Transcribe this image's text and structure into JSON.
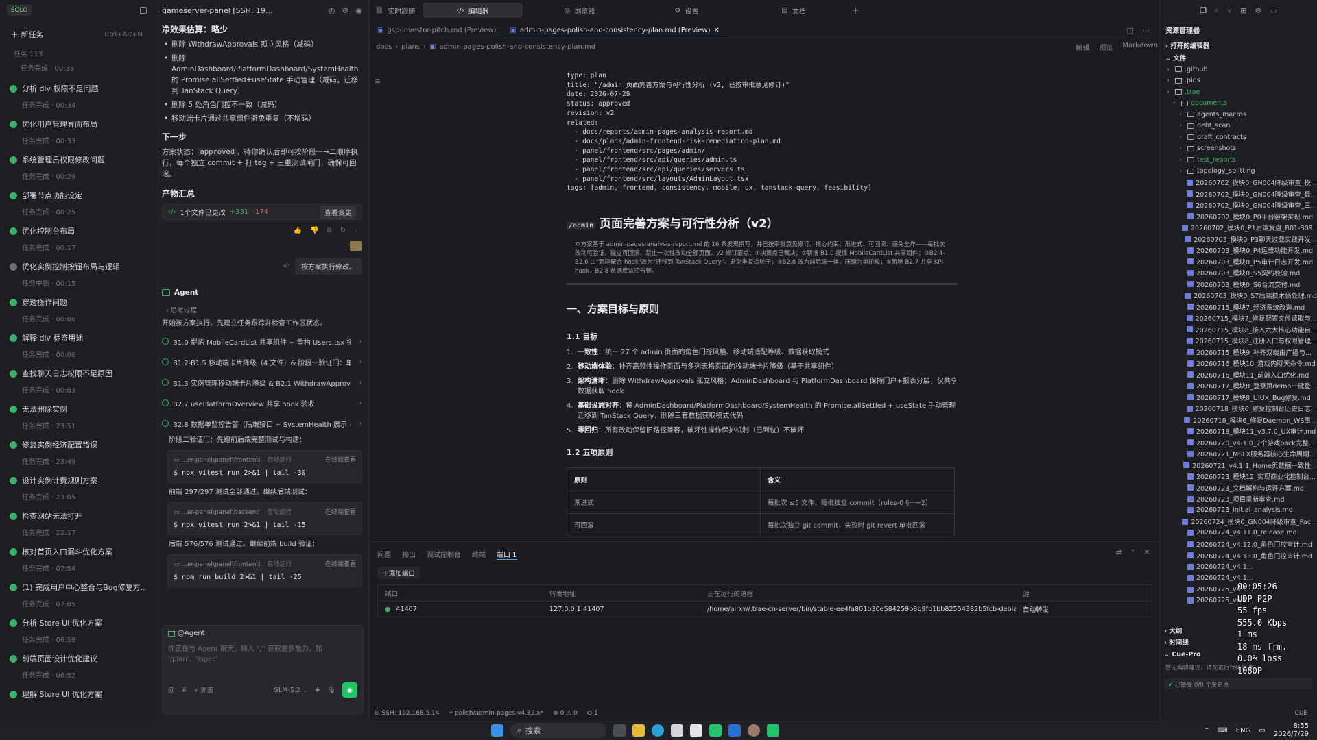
{
  "window": {
    "title": "gameserver-panel [SSH: 19...",
    "logo": "SOLO"
  },
  "top_tabs": [
    {
      "label": "实时跟随",
      "icon": "link-icon"
    },
    {
      "label": "编辑器",
      "icon": "code-icon"
    },
    {
      "label": "浏览器",
      "icon": "globe-icon"
    },
    {
      "label": "设置",
      "icon": "gear-icon"
    },
    {
      "label": "文档",
      "icon": "doc-icon"
    }
  ],
  "tasks": {
    "new_task": "新任务",
    "shortcut": "Ctrl+Alt+N",
    "count_label": "任务  113",
    "first_sub": "任务完成 · 00:35",
    "items": [
      {
        "title": "分析 div 权限不足问题",
        "sub": "任务完成 · 00:34",
        "status": "done"
      },
      {
        "title": "优化用户管理界面布局",
        "sub": "任务完成 · 00:33",
        "status": "done"
      },
      {
        "title": "系统管理员权限修改问题",
        "sub": "任务完成 · 00:29",
        "status": "done"
      },
      {
        "title": "部署节点功能设定",
        "sub": "任务完成 · 00:25",
        "status": "done"
      },
      {
        "title": "优化控制台布局",
        "sub": "任务完成 · 00:17",
        "status": "done"
      },
      {
        "title": "优化实例控制按钮布局与逻辑",
        "sub": "任务中断 · 00:15",
        "status": "stopped"
      },
      {
        "title": "穿透操作问题",
        "sub": "任务完成 · 00:06",
        "status": "done"
      },
      {
        "title": "解释 div 标签用途",
        "sub": "任务完成 · 00:06",
        "status": "done"
      },
      {
        "title": "查找聊天日志权限不足原因",
        "sub": "任务完成 · 00:03",
        "status": "done"
      },
      {
        "title": "无法删除实例",
        "sub": "任务完成 · 23:51",
        "status": "done"
      },
      {
        "title": "修复实例经济配置错误",
        "sub": "任务完成 · 23:49",
        "status": "done"
      },
      {
        "title": "设计实例计费规则方案",
        "sub": "任务完成 · 23:05",
        "status": "done"
      },
      {
        "title": "检查网站无法打开",
        "sub": "任务完成 · 22:17",
        "status": "done"
      },
      {
        "title": "核对首页入口漏斗优化方案",
        "sub": "任务完成 · 07:54",
        "status": "done"
      },
      {
        "title": "(1) 完成用户中心整合与Bug修复方...",
        "sub": "任务完成 · 07:05",
        "status": "done"
      },
      {
        "title": "分析 Store UI 优化方案",
        "sub": "任务完成 · 06:59",
        "status": "done"
      },
      {
        "title": "前端页面设计优化建议",
        "sub": "任务完成 · 06:52",
        "status": "done"
      },
      {
        "title": "理解 Store UI 优化方案",
        "sub": "",
        "status": "done"
      }
    ]
  },
  "chat": {
    "section1_title": "净效果估算：略少",
    "bullets": [
      "删除 WithdrawApprovals 孤立风格（减码）",
      "删除 AdminDashboard/PlatformDashboard/SystemHealth 的 Promise.allSettled+useState 手动管理（减码，迁移到 TanStack Query）",
      "删除 5 处角色门控不一致（减码）",
      "移动端卡片通过共享组件避免重复（不增码）"
    ],
    "next_title": "下一步",
    "next_text_a": "方案状态：",
    "next_code": "approved",
    "next_text_b": "，待你确认后即可按阶段一→二顺序执行，每个独立 commit + 打 tag + 三重测试闸门，确保可回滚。",
    "summary_title": "产物汇总",
    "changes": "1个文件已更改",
    "adds": "+331",
    "dels": "-174",
    "view_changes": "查看变更",
    "user_msg": "按方案执行修改。",
    "agent_label": "Agent",
    "thinking": "思考过程",
    "start_text": "开始按方案执行。先建立任务跟踪并检查工作区状态。",
    "steps": [
      "B1.0 提炼 MobileCardList 共享组件 + 重构 Users.tsx 接入...",
      "B1.2-B1.5 移动端卡片降级（4 文件）& 阶段一验证门：单测...",
      "B1.3 实例管理移动端卡片降级 & B2.1 WithdrawApprovals 风...",
      "B2.7 usePlatformOverview 共享 hook 验收",
      "B2.8 数据单监控告警（后端接口 + SystemHealth 展示 + 单测）"
    ],
    "phase2": "阶段二验证门：先跑前后端完整测试与构建：",
    "terms": [
      {
        "path": "...er-panel\\panel\\frontend",
        "mode": "自动运行",
        "open": "在终端查看",
        "cmd": "$ npx vitest run 2>&1 | tail -30"
      },
      {
        "path": "...er-panel\\panel\\backend",
        "mode": "自动运行",
        "open": "在终端查看",
        "cmd": "$ npx vitest run 2>&1 | tail -15"
      },
      {
        "path": "...er-panel\\panel\\frontend",
        "mode": "自动运行",
        "open": "在终端查看",
        "cmd": "$ npm run build 2>&1 | tail -25"
      }
    ],
    "front_pass": "前端 297/297 测试全部通过。继续后端测试：",
    "back_pass": "后端 576/576 测试通过。继续前端 build 验证：",
    "input_mention": "@Agent",
    "input_placeholder": "你正在与 Agent 聊天，输入 \"/\" 获取更多能力，如 '/plan'、'/spec'",
    "model": "GLM-5.2",
    "source_btn": "溯源"
  },
  "editor": {
    "file_tabs": [
      "gsp-investor-pitch.md (Preview)",
      "admin-pages-polish-and-consistency-plan.md (Preview)"
    ],
    "breadcrumb": [
      "docs",
      "plans",
      "admin-pages-polish-and-consistency-plan.md"
    ],
    "view_modes": [
      "编辑",
      "预览",
      "Markdown"
    ],
    "frontmatter": "type: plan\ntitle: \"/admin 页面完善方案与可行性分析 (v2, 已按审批意见修订)\"\ndate: 2026-07-29\nstatus: approved\nrevision: v2\nrelated:\n  - docs/reports/admin-pages-analysis-report.md\n  - docs/plans/admin-frontend-risk-remediation-plan.md\n  - panel/frontend/src/pages/admin/\n  - panel/frontend/src/api/queries/admin.ts\n  - panel/frontend/src/api/queries/servers.ts\n  - panel/frontend/src/layouts/AdminLayout.tsx\ntags: [admin, frontend, consistency, mobile, ux, tanstack-query, feasibility]",
    "h1_code": "/admin",
    "h1": "页面完善方案与可行性分析（v2）",
    "intro": "本方案基于 admin-pages-analysis-report.md 的 16 条发现撰写，并已按审批意见修订。核心约束：渐进式、可回滚、避免全炸——每批次改动可验证，独立可回滚，禁止一次性改动全部页面。v2 修订要点：①决策点已裁决；②新增 B1.0 提炼 MobileCardList 共享组件；③B2.4-B2.6 由\"新建聚合 hook\"改为\"迁移到 TanStack Query\"，避免重复造轮子；④B2.8 改为前后端一体，压缩为单阶段；⑤新增 B2.7 共享 KPI hook，B2.8 数据库监控告警。",
    "h2": "一、方案目标与原则",
    "h3a": "1.1 目标",
    "goals": [
      {
        "b": "一致性",
        "t": "：统一 27 个 admin 页面的角色门控风格、移动端适配等级、数据获取模式"
      },
      {
        "b": "移动端体验",
        "t": "：补齐高频性操作页面与多列表格页面的移动端卡片降级（基于共享组件）"
      },
      {
        "b": "架构清晰",
        "t": "：删除 WithdrawApprovals 孤立风格；AdminDashboard 与 PlatformDashboard 保持门户+报表分层，仅共享数据获取 hook"
      },
      {
        "b": "基础设施对齐",
        "t": "：将 AdminDashboard/PlatformDashboard/SystemHealth 的 Promise.allSettled + useState 手动管理迁移到 TanStack Query，删除三套数据获取模式代码"
      },
      {
        "b": "零回归",
        "t": "：所有改动保留旧路径兼容，破坏性操作保护机制（已到位）不破坏"
      }
    ],
    "h3b": "1.2 五项原则",
    "table_head": [
      "原则",
      "含义"
    ],
    "table_rows": [
      [
        "渐进式",
        "每批次 ≤5 文件，每批独立 commit（rules-0 §一~2）"
      ],
      [
        "可回滚",
        "每批次独立 git commit，失败时 git revert 单批回滚"
      ]
    ]
  },
  "panel": {
    "tabs": [
      "问题",
      "输出",
      "调试控制台",
      "终端",
      "端口  1"
    ],
    "add_port": "添加端口",
    "head": [
      "端口",
      "转发地址",
      "正在运行的进程",
      "源"
    ],
    "rows": [
      [
        "41407",
        "127.0.0.1:41407",
        "/home/airxw/.trae-cn-server/bin/stable-ee4fa801b30e584259b8b9fb1bb82554382b5fcb-debian10/...",
        "自动转发"
      ]
    ]
  },
  "explorer": {
    "title": "资源管理器",
    "open_editors": "打开的编辑器",
    "files": "文件",
    "tree": [
      {
        "name": ".github",
        "type": "folder",
        "lvl": 1
      },
      {
        "name": ".pids",
        "type": "folder",
        "lvl": 1
      },
      {
        "name": ".trae",
        "type": "folder",
        "lvl": 1,
        "color": "#3fae6a"
      },
      {
        "name": "documents",
        "type": "folder",
        "lvl": 2,
        "color": "#3fae6a"
      },
      {
        "name": "agents_macros",
        "type": "folder",
        "lvl": 3
      },
      {
        "name": "debt_scan",
        "type": "folder",
        "lvl": 3
      },
      {
        "name": "draft_contracts",
        "type": "folder",
        "lvl": 3
      },
      {
        "name": "screenshots",
        "type": "folder",
        "lvl": 3
      },
      {
        "name": "test_reports",
        "type": "folder",
        "lvl": 3,
        "color": "#3fae6a"
      },
      {
        "name": "topology_splitting",
        "type": "folder",
        "lvl": 3
      },
      {
        "name": "20260702_模块0_GN004降级审查_模...",
        "type": "md",
        "lvl": 3
      },
      {
        "name": "20260702_模块0_GN004降级审查_最...",
        "type": "md",
        "lvl": 3
      },
      {
        "name": "20260702_模块0_GN004降级审查_三...",
        "type": "md",
        "lvl": 3
      },
      {
        "name": "20260702_模块0_P0平台容架实现.md",
        "type": "md",
        "lvl": 3
      },
      {
        "name": "20260702_模块0_P1后端复盘_B01-B09...",
        "type": "md",
        "lvl": 3
      },
      {
        "name": "20260703_模块0_P3聊天过载实践开发...",
        "type": "md",
        "lvl": 3
      },
      {
        "name": "20260703_模块0_P4运维功能开发.md",
        "type": "md",
        "lvl": 3
      },
      {
        "name": "20260703_模块0_P5审计日志开发.md",
        "type": "md",
        "lvl": 3
      },
      {
        "name": "20260703_模块0_S5契约校验.md",
        "type": "md",
        "lvl": 3
      },
      {
        "name": "20260703_模块0_S6合流交付.md",
        "type": "md",
        "lvl": 3
      },
      {
        "name": "20260703_模块0_S7后端技术债处理.md",
        "type": "md",
        "lvl": 3
      },
      {
        "name": "20260715_模块7_经济系统改造.md",
        "type": "md",
        "lvl": 3
      },
      {
        "name": "20260715_模块7_修复配置文件读取与...",
        "type": "md",
        "lvl": 3
      },
      {
        "name": "20260715_模块8_接入六大核心功能自...",
        "type": "md",
        "lvl": 3
      },
      {
        "name": "20260715_模块8_注册入口与权限管理...",
        "type": "md",
        "lvl": 3
      },
      {
        "name": "20260715_模块9_补齐双端由广播与...",
        "type": "md",
        "lvl": 3
      },
      {
        "name": "20260716_模块10_游戏内聊天命令.md",
        "type": "md",
        "lvl": 3
      },
      {
        "name": "20260716_模块11_前端入口优化.md",
        "type": "md",
        "lvl": 3
      },
      {
        "name": "20260717_模块8_登录页demo一键登...",
        "type": "md",
        "lvl": 3
      },
      {
        "name": "20260717_模块8_UIUX_Bug修复.md",
        "type": "md",
        "lvl": 3
      },
      {
        "name": "20260718_模块6_修复控制台历史日志...",
        "type": "md",
        "lvl": 3
      },
      {
        "name": "20260718_模块6_修复Daemon_WS事...",
        "type": "md",
        "lvl": 3
      },
      {
        "name": "20260718_模块11_v3.7.0_UX审计.md",
        "type": "md",
        "lvl": 3
      },
      {
        "name": "20260720_v4.1.0_7个游戏pack完整...",
        "type": "md",
        "lvl": 3
      },
      {
        "name": "20260721_MSLX服务器核心生命周期...",
        "type": "md",
        "lvl": 3
      },
      {
        "name": "20260721_v4.1.1_Home页数据一致性...",
        "type": "md",
        "lvl": 3
      },
      {
        "name": "20260723_模块12_实现商业化控制台...",
        "type": "md",
        "lvl": 3
      },
      {
        "name": "20260723_文档解构与运评方案.md",
        "type": "md",
        "lvl": 3
      },
      {
        "name": "20260723_项目重新审查.md",
        "type": "md",
        "lvl": 3
      },
      {
        "name": "20260723_initial_analysis.md",
        "type": "md",
        "lvl": 3
      },
      {
        "name": "20260724_模块0_GN004降级审查_Pac...",
        "type": "md",
        "lvl": 3
      },
      {
        "name": "20260724_v4.11.0_release.md",
        "type": "md",
        "lvl": 3
      },
      {
        "name": "20260724_v4.12.0_角色门控审计.md",
        "type": "md",
        "lvl": 3
      },
      {
        "name": "20260724_v4.13.0_角色门控审计.md",
        "type": "md",
        "lvl": 3
      },
      {
        "name": "20260724_v4.1...",
        "type": "md",
        "lvl": 3
      },
      {
        "name": "20260724_v4.1...",
        "type": "md",
        "lvl": 3
      },
      {
        "name": "20260725_v4.1...",
        "type": "md",
        "lvl": 3
      },
      {
        "name": "20260725_v4.1...",
        "type": "md",
        "lvl": 3
      }
    ],
    "outline": "大纲",
    "timeline": "时间线",
    "cue": "Cue-Pro",
    "cue_text": "暂无编辑建议，请先进行代码修改",
    "applied": "已接受 0/0 个变更点"
  },
  "overlay_stats": [
    "00:05:26",
    "UDP P2P",
    "55 fps",
    "555.0 Kbps",
    "1 ms",
    "18 ms frm.",
    "0.0% loss",
    "1080P"
  ],
  "statusbar": {
    "ssh": "SSH: 192.168.5.14",
    "branch": "polish/admin-pages-v4.32.x*",
    "errors": "0",
    "warnings": "0",
    "ports": "1",
    "cue": "CUE"
  },
  "taskbar": {
    "search": "搜索",
    "lang": "ENG",
    "time": "8:55",
    "date": "2026/7/29"
  }
}
